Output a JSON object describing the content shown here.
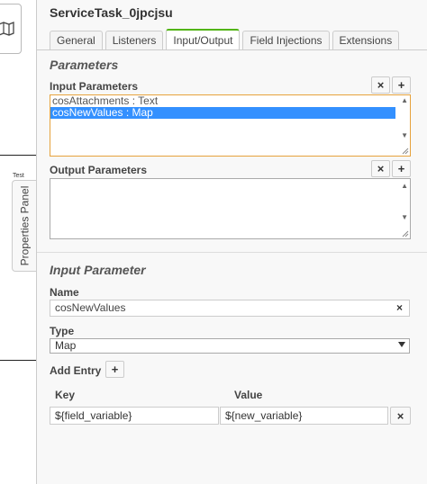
{
  "canvas": {
    "tool_icon": "map-icon",
    "annotation_text": "Test",
    "properties_tab_label": "Properties Panel"
  },
  "panel": {
    "title": "ServiceTask_0jpcjsu",
    "tabs": [
      {
        "label": "General",
        "active": false
      },
      {
        "label": "Listeners",
        "active": false
      },
      {
        "label": "Input/Output",
        "active": true
      },
      {
        "label": "Field Injections",
        "active": false
      },
      {
        "label": "Extensions",
        "active": false
      }
    ],
    "accent_color": "#52b415"
  },
  "parameters": {
    "group_title": "Parameters",
    "input_label": "Input Parameters",
    "input_items": [
      {
        "text": "cosAttachments : Text",
        "selected": false
      },
      {
        "text": "cosNewValues : Map",
        "selected": true
      }
    ],
    "output_label": "Output Parameters",
    "remove_symbol": "×",
    "add_symbol": "+"
  },
  "input_parameter": {
    "group_title": "Input Parameter",
    "name_label": "Name",
    "name_value": "cosNewValues",
    "type_label": "Type",
    "type_value": "Map",
    "add_entry_label": "Add Entry",
    "key_header": "Key",
    "value_header": "Value",
    "entries": [
      {
        "key": "${field_variable}",
        "value": "${new_variable}"
      }
    ],
    "clear_symbol": "×"
  },
  "colors": {
    "selection": "#3390ff",
    "focus_border": "#e6a23c"
  }
}
